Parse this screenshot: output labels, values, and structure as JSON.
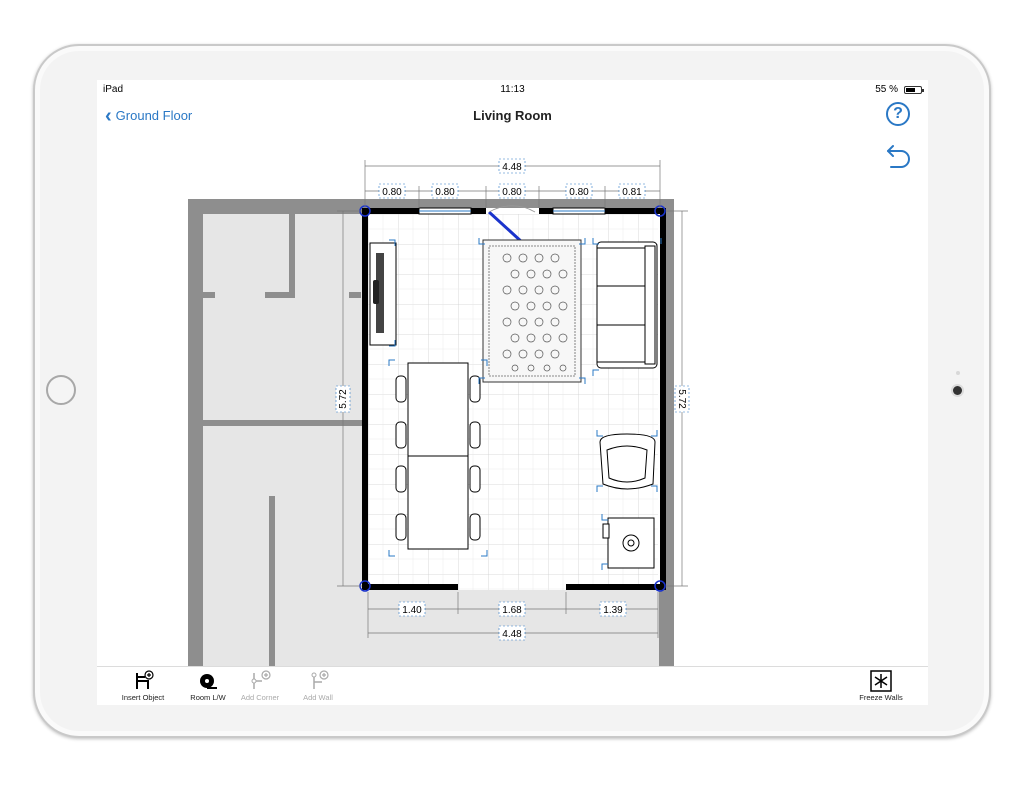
{
  "status_bar": {
    "carrier": "iPad",
    "time": "11:13",
    "battery": "55 %"
  },
  "nav": {
    "back_label": "Ground Floor",
    "title": "Living Room",
    "help": "?"
  },
  "dimensions": {
    "top_total": "4.48",
    "top_segments": [
      "0.80",
      "0.80",
      "0.80",
      "0.80",
      "0.81"
    ],
    "left": "5.72",
    "right": "5.72",
    "bottom_segments": [
      "1.40",
      "1.68",
      "1.39"
    ],
    "bottom_total": "4.48"
  },
  "toolbar": {
    "insert_object": "Insert Object",
    "room_lw": "Room L/W",
    "add_corner": "Add Corner",
    "add_wall": "Add Wall",
    "freeze_walls": "Freeze Walls"
  },
  "colors": {
    "accent": "#2a78c5",
    "wall": "#000000",
    "neighbor_wall": "#8e8e8e",
    "neighbor_floor": "#e6e6e6",
    "handle": "#1a33cc"
  }
}
